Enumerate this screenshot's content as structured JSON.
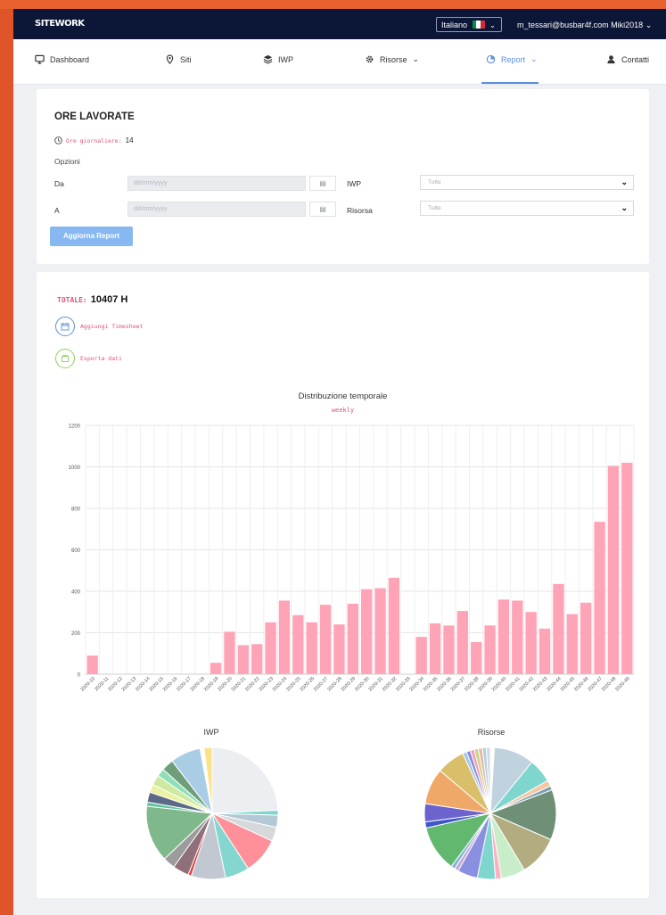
{
  "navbar": {
    "logo": "SITEWORK",
    "language": "Italiano",
    "flag_colors": [
      "#009246",
      "#ffffff",
      "#ce2b37"
    ],
    "user": "m_tessari@busbar4f.com Miki2018"
  },
  "menu": [
    {
      "label": "Dashboard",
      "icon": "monitor-icon"
    },
    {
      "label": "Siti",
      "icon": "map-pin-icon"
    },
    {
      "label": "IWP",
      "icon": "layers-icon"
    },
    {
      "label": "Risorse",
      "icon": "gear-icon",
      "dropdown": true
    },
    {
      "label": "Report",
      "icon": "pie-chart-icon",
      "dropdown": true,
      "active": true
    },
    {
      "label": "Contatti",
      "icon": "contacts-icon"
    }
  ],
  "filters": {
    "title": "ORE LAVORATE",
    "ore_label": "Ore giornaliere:",
    "ore_value": "14",
    "opzioni": "Opzioni",
    "da_label": "Da",
    "a_label": "A",
    "date_placeholder": "dd/mm/yyyy",
    "iwp_label": "IWP",
    "iwp_value": "Tutte",
    "risorsa_label": "Risorsa",
    "risorsa_value": "Tutte",
    "button": "Aggiorna Report"
  },
  "summary": {
    "totale_label": "TOTALE:",
    "totale_value": "10407 H",
    "add_timesheet": "Aggiungi Timesheet",
    "export": "Esporta dati"
  },
  "colors": {
    "accent": "#5b8fd9",
    "pink_text": "#e0507a",
    "bar": "#ffa3b6"
  },
  "chart_data": [
    {
      "type": "bar",
      "title": "Distribuzione temporale",
      "subtitle": "weekly",
      "categories": [
        "2020-10",
        "2020-11",
        "2020-12",
        "2020-13",
        "2020-14",
        "2020-15",
        "2020-16",
        "2020-17",
        "2020-18",
        "2020-19",
        "2020-20",
        "2020-21",
        "2020-22",
        "2020-23",
        "2020-24",
        "2020-25",
        "2020-26",
        "2020-27",
        "2020-28",
        "2020-29",
        "2020-30",
        "2020-31",
        "2020-32",
        "2020-33",
        "2020-34",
        "2020-35",
        "2020-36",
        "2020-37",
        "2020-38",
        "2020-39",
        "2020-40",
        "2020-41",
        "2020-42",
        "2020-43",
        "2020-44",
        "2020-45",
        "2020-46",
        "2020-47",
        "2020-48",
        "2020-49"
      ],
      "values": [
        90,
        0,
        0,
        0,
        0,
        0,
        0,
        0,
        0,
        55,
        205,
        140,
        145,
        250,
        355,
        285,
        250,
        335,
        240,
        340,
        410,
        415,
        465,
        0,
        180,
        245,
        235,
        305,
        155,
        235,
        360,
        355,
        300,
        220,
        435,
        290,
        345,
        735,
        1005,
        1020
      ],
      "ylim": [
        0,
        1200
      ],
      "yticks": [
        0,
        200,
        400,
        600,
        800,
        1000,
        1200
      ],
      "grid": true
    },
    {
      "type": "pie",
      "title": "IWP",
      "slices": [
        {
          "value": 24.5,
          "color": "#eceef1"
        },
        {
          "value": 1.2,
          "color": "#7fd6cf"
        },
        {
          "value": 3.0,
          "color": "#b4c9d6"
        },
        {
          "value": 3.5,
          "color": "#d6d9dc"
        },
        {
          "value": 9.0,
          "color": "#ff8f99"
        },
        {
          "value": 6.0,
          "color": "#84d6cf"
        },
        {
          "value": 8.5,
          "color": "#c2c8d2"
        },
        {
          "value": 0.8,
          "color": "#e23c3c"
        },
        {
          "value": 4.0,
          "color": "#8f6f79"
        },
        {
          "value": 3.0,
          "color": "#9c9c9c"
        },
        {
          "value": 14.0,
          "color": "#7fb98b"
        },
        {
          "value": 1.0,
          "color": "#5ec7a0"
        },
        {
          "value": 2.5,
          "color": "#5d6a86"
        },
        {
          "value": 2.0,
          "color": "#eaf2a3"
        },
        {
          "value": 2.5,
          "color": "#cfe9a0"
        },
        {
          "value": 2.0,
          "color": "#8fe0b8"
        },
        {
          "value": 3.0,
          "color": "#6f9f7a"
        },
        {
          "value": 7.5,
          "color": "#a9cde4"
        },
        {
          "value": 1.0,
          "color": "#ffffff"
        },
        {
          "value": 2.0,
          "color": "#fde18a"
        }
      ]
    },
    {
      "type": "pie",
      "title": "Risorse",
      "slices": [
        {
          "value": 1.0,
          "color": "#ffffff"
        },
        {
          "value": 10.0,
          "color": "#bfd2de"
        },
        {
          "value": 6.0,
          "color": "#7fd6cf"
        },
        {
          "value": 1.5,
          "color": "#f5c6a0"
        },
        {
          "value": 1.0,
          "color": "#7a9eb0"
        },
        {
          "value": 12.5,
          "color": "#6f9077"
        },
        {
          "value": 10.0,
          "color": "#b3ac80"
        },
        {
          "value": 6.0,
          "color": "#c8eec9"
        },
        {
          "value": 1.5,
          "color": "#ffb0c0"
        },
        {
          "value": 4.5,
          "color": "#7ed6cf"
        },
        {
          "value": 5.0,
          "color": "#8b8fe0"
        },
        {
          "value": 1.0,
          "color": "#c8a7d6"
        },
        {
          "value": 1.0,
          "color": "#7fb7d4"
        },
        {
          "value": 11.5,
          "color": "#63b870"
        },
        {
          "value": 1.5,
          "color": "#3f57c6"
        },
        {
          "value": 4.5,
          "color": "#6c63cf"
        },
        {
          "value": 9.0,
          "color": "#f0a868"
        },
        {
          "value": 7.0,
          "color": "#d9bf6a"
        },
        {
          "value": 1.0,
          "color": "#a0c8e8"
        },
        {
          "value": 1.0,
          "color": "#8a8ae0"
        },
        {
          "value": 1.0,
          "color": "#f4a2b6"
        },
        {
          "value": 1.0,
          "color": "#c6d58b"
        },
        {
          "value": 1.0,
          "color": "#e8b7a0"
        },
        {
          "value": 1.0,
          "color": "#b2d0e8"
        },
        {
          "value": 1.0,
          "color": "#d6d9dc"
        }
      ]
    }
  ]
}
